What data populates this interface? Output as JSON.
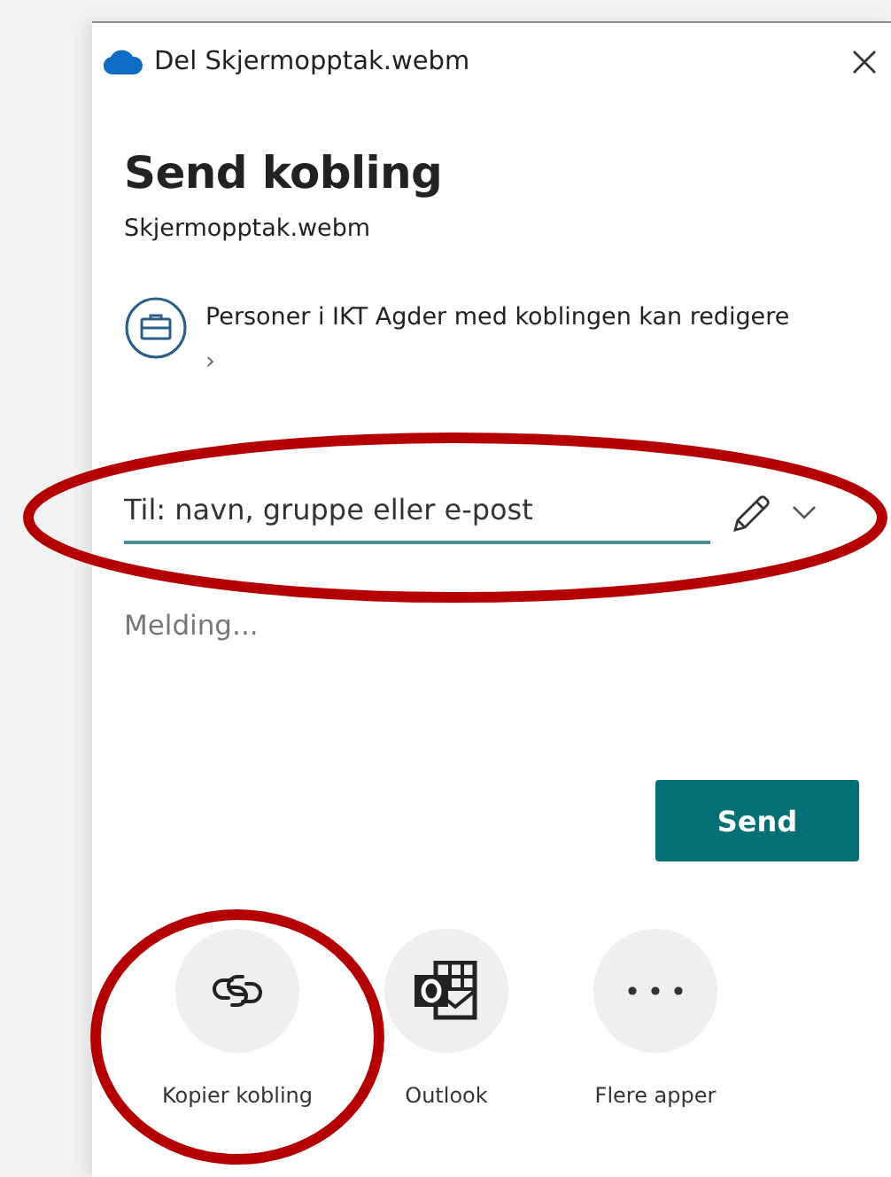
{
  "window": {
    "title": "Del Skjermopptak.webm"
  },
  "heading": "Send kobling",
  "filename": "Skjermopptak.webm",
  "permission": {
    "text": "Personer i IKT Agder med koblingen kan redigere",
    "chevron": "›"
  },
  "recipient": {
    "placeholder": "Til: navn, gruppe eller e-post"
  },
  "message": {
    "placeholder": "Melding..."
  },
  "send_button": "Send",
  "apps": [
    {
      "kind": "link",
      "label": "Kopier kobling"
    },
    {
      "kind": "outlook",
      "label": "Outlook"
    },
    {
      "kind": "more",
      "label": "Flere apper"
    }
  ]
}
